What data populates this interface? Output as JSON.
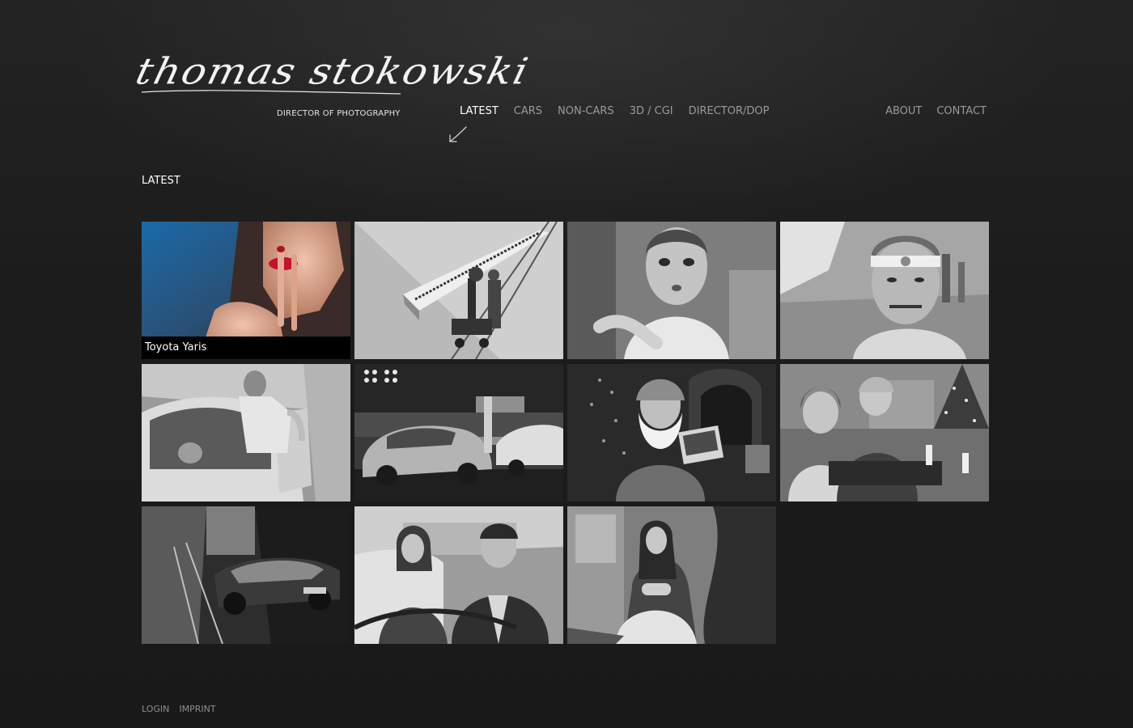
{
  "header": {
    "logo_script": "thomas stokowski",
    "logo_subtitle": "DIRECTOR OF PHOTOGRAPHY"
  },
  "nav": {
    "main": [
      {
        "label": "LATEST",
        "active": true
      },
      {
        "label": "CARS",
        "active": false
      },
      {
        "label": "NON-CARS",
        "active": false
      },
      {
        "label": "3D / CGI",
        "active": false
      },
      {
        "label": "DIRECTOR/DOP",
        "active": false
      }
    ],
    "secondary": [
      {
        "label": "ABOUT"
      },
      {
        "label": "CONTACT"
      }
    ],
    "arrow_icon": "hand-drawn-arrow-icon"
  },
  "main": {
    "section_title": "LATEST",
    "tiles": [
      {
        "name": "woman-red-lips",
        "caption": "Toyota Yaris",
        "color": true
      },
      {
        "name": "piano-camera-dolly",
        "caption": "",
        "color": false
      },
      {
        "name": "woman-surprised",
        "caption": "",
        "color": false
      },
      {
        "name": "man-headband",
        "caption": "",
        "color": false
      },
      {
        "name": "man-car-door",
        "caption": "",
        "color": false
      },
      {
        "name": "cars-showroom",
        "caption": "",
        "color": false
      },
      {
        "name": "santa-claus",
        "caption": "",
        "color": false
      },
      {
        "name": "children-christmas",
        "caption": "",
        "color": false
      },
      {
        "name": "concept-car-street",
        "caption": "",
        "color": false
      },
      {
        "name": "couple-in-car",
        "caption": "",
        "color": false
      },
      {
        "name": "woman-kitchen",
        "caption": "",
        "color": false
      }
    ]
  },
  "footer": {
    "links": [
      {
        "label": "LOGIN"
      },
      {
        "label": "IMPRINT"
      }
    ]
  },
  "colors": {
    "background": "#1b1b1b",
    "nav_active": "#ffffff",
    "nav_inactive": "#9a9a9a",
    "caption_bg": "#000000",
    "lips_red": "#c8102e"
  }
}
